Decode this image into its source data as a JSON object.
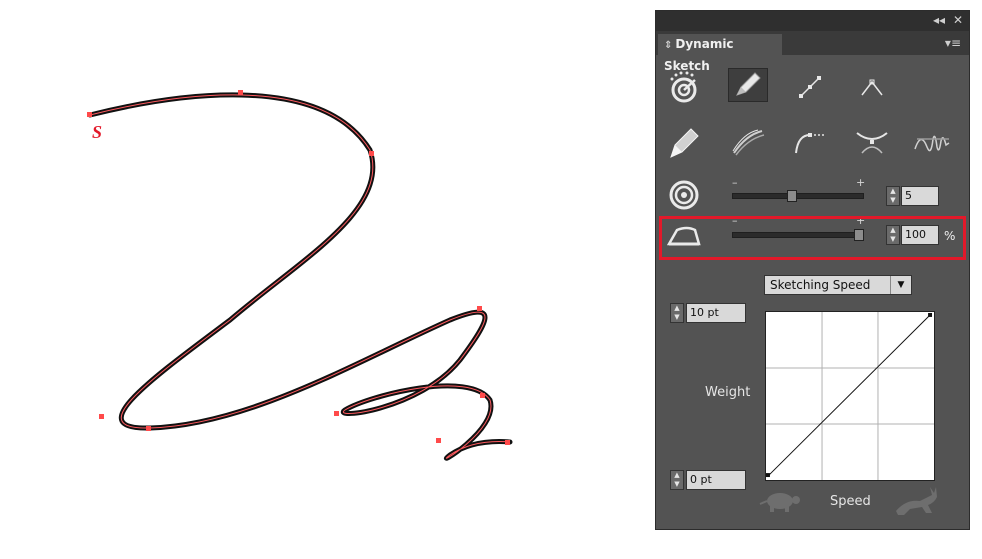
{
  "panel": {
    "title": "Dynamic Sketch",
    "window_controls": {
      "collapse": "◂◂",
      "close": "✕"
    },
    "menu_icon": "panel-menu-icon",
    "tools_row1": [
      {
        "name": "recognition-tool",
        "icon": "target-dots-icon"
      },
      {
        "name": "pencil-tool",
        "icon": "pencil-icon",
        "selected": true
      },
      {
        "name": "straight-segment-tool",
        "icon": "line-segment-icon"
      },
      {
        "name": "corner-tool",
        "icon": "corner-icon"
      }
    ],
    "tools_row2": [
      {
        "name": "pen-nib-tool",
        "icon": "pen-nib-icon"
      },
      {
        "name": "strokes-style",
        "icon": "strokes-icon"
      },
      {
        "name": "curve-style",
        "icon": "curve-dotted-icon"
      },
      {
        "name": "cross-style",
        "icon": "cross-curve-icon"
      },
      {
        "name": "scribble-style",
        "icon": "scribble-icon"
      }
    ],
    "precision": {
      "icon": "concentric-circles-icon",
      "minus": "–",
      "plus": "+",
      "value": "5",
      "level": 0.45
    },
    "smoothing": {
      "icon": "iron-icon",
      "minus": "–",
      "plus": "+",
      "value": "100",
      "unit": "%",
      "level": 1.0
    },
    "dropdown": {
      "selected": "Sketching Speed"
    },
    "weight": {
      "label": "Weight",
      "max": "10 pt",
      "min": "0 pt"
    },
    "speed_label": "Speed",
    "slow_icon": "turtle-icon",
    "fast_icon": "rabbit-icon"
  },
  "canvas_marker": "S",
  "highlight_color": "#e3192a"
}
